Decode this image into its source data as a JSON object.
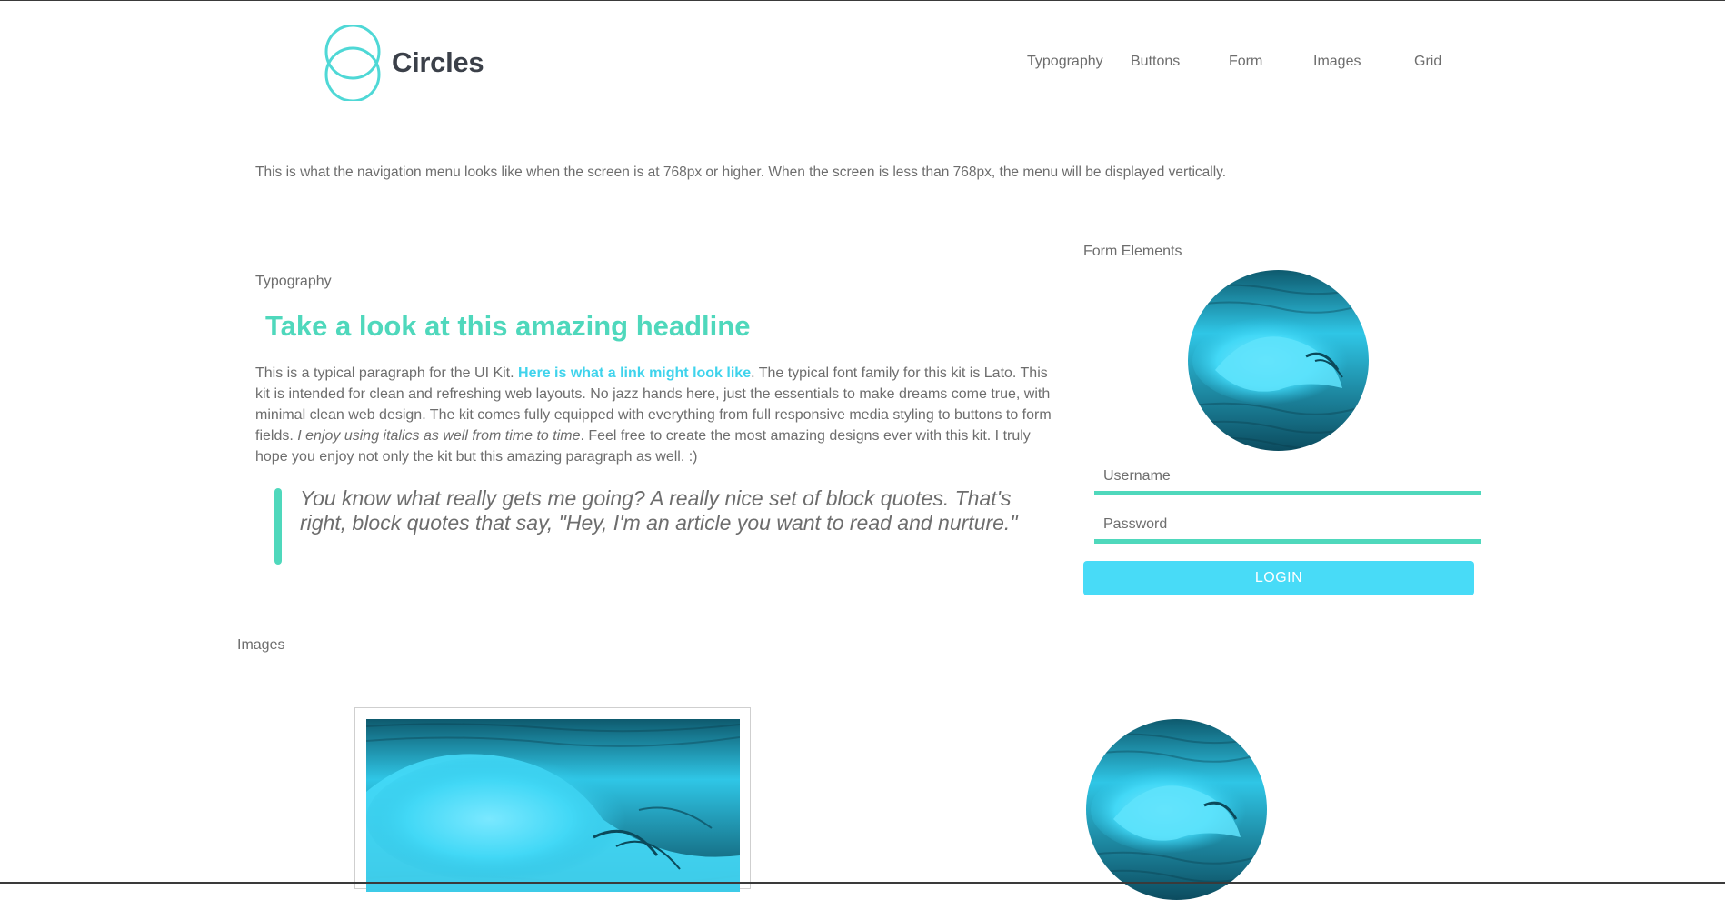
{
  "brand": {
    "name": "Circles",
    "accent_color": "#4fd8bc",
    "link_color": "#3fd3ec",
    "button_color": "#48dbf7"
  },
  "nav": {
    "items": [
      {
        "label": "Typography"
      },
      {
        "label": "Buttons"
      },
      {
        "label": "Form"
      },
      {
        "label": "Images"
      },
      {
        "label": "Grid"
      }
    ]
  },
  "nav_note": "This is what the navigation menu looks like when the screen is at 768px or higher. When the screen is less than 768px, the menu will be displayed vertically.",
  "typography": {
    "section_label": "Typography",
    "headline": "Take a look at this amazing headline",
    "paragraph": {
      "part1": "This is a typical paragraph for the UI Kit. ",
      "link": "Here is what a link might look like",
      "part2": ". The typical font family for this kit is Lato. This kit is intended for clean and refreshing web layouts. No jazz hands here, just the essentials to make dreams come true, with minimal clean web design. The kit comes fully equipped with everything from full responsive media styling to buttons to form fields. ",
      "italic": "I enjoy using italics as well from time to time",
      "part3": ". Feel free to create the most amazing designs ever with this kit. I truly hope you enjoy not only the kit but this amazing paragraph as well. :)"
    },
    "blockquote": "You know what really gets me going? A really nice set of block quotes. That's right, block quotes that say, \"Hey, I'm an article you want to read and nurture.\""
  },
  "form": {
    "section_label": "Form Elements",
    "username_placeholder": "Username",
    "password_placeholder": "Password",
    "login_label": "LOGIN",
    "avatar_icon": "ocean-wave-image"
  },
  "images": {
    "section_label": "Images",
    "framed_image_icon": "ocean-wave-image",
    "circle_image_icon": "ocean-wave-image"
  }
}
